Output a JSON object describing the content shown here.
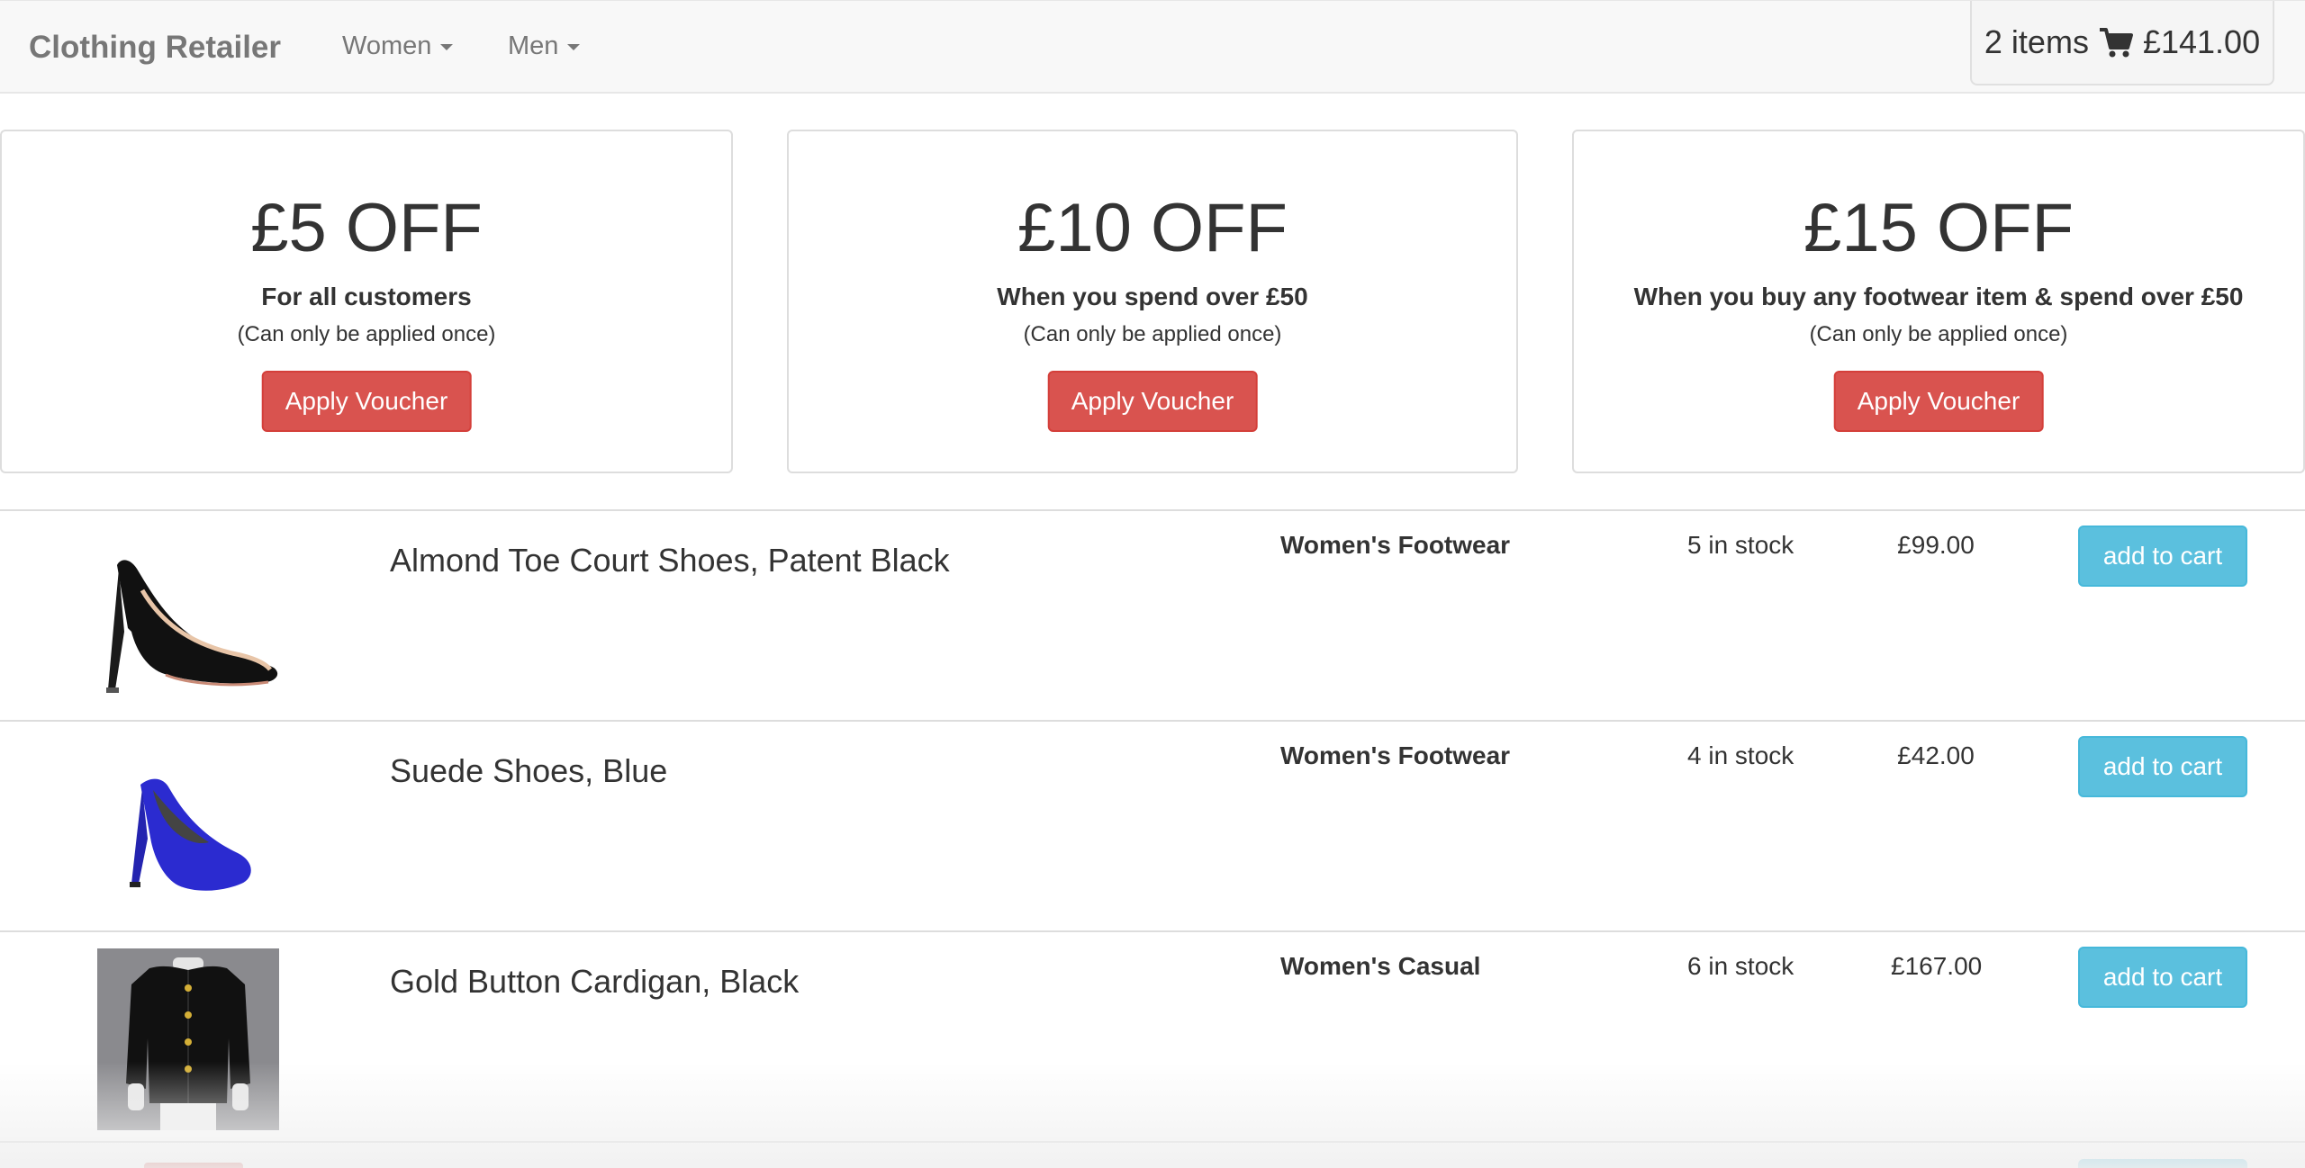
{
  "navbar": {
    "brand": "Clothing Retailer",
    "menus": [
      {
        "label": "Women"
      },
      {
        "label": "Men"
      }
    ],
    "cart": {
      "items_label": "2 items",
      "total": "£141.00"
    }
  },
  "vouchers": [
    {
      "amount": "£5 OFF",
      "condition": "For all customers",
      "note": "(Can only be applied once)",
      "button": "Apply Voucher"
    },
    {
      "amount": "£10 OFF",
      "condition": "When you spend over £50",
      "note": "(Can only be applied once)",
      "button": "Apply Voucher"
    },
    {
      "amount": "£15 OFF",
      "condition": "When you buy any footwear item & spend over £50",
      "note": "(Can only be applied once)",
      "button": "Apply Voucher"
    }
  ],
  "products": [
    {
      "name": "Almond Toe Court Shoes, Patent Black",
      "category": "Women's Footwear",
      "stock": "5 in stock",
      "price": "£99.00",
      "button": "add to cart",
      "image": "black-heel-icon"
    },
    {
      "name": "Suede Shoes, Blue",
      "category": "Women's Footwear",
      "stock": "4 in stock",
      "price": "£42.00",
      "button": "add to cart",
      "image": "blue-heel-icon"
    },
    {
      "name": "Gold Button Cardigan, Black",
      "category": "Women's Casual",
      "stock": "6 in stock",
      "price": "£167.00",
      "button": "add to cart",
      "image": "cardigan-icon"
    }
  ],
  "colors": {
    "danger": "#d9534f",
    "info": "#5bc0de",
    "navbar_bg": "#f8f8f8"
  }
}
